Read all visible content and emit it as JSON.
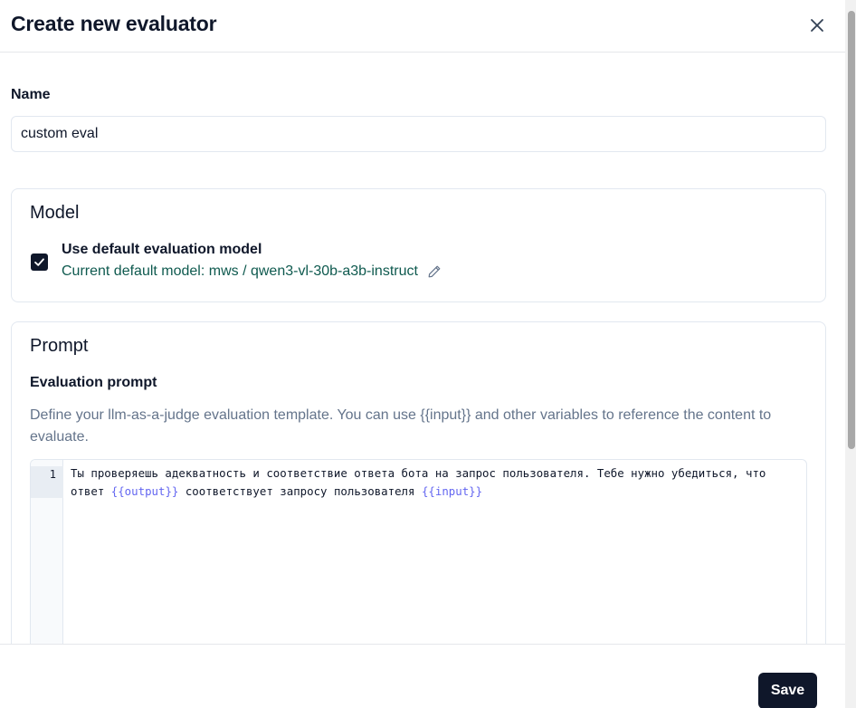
{
  "dialog": {
    "title": "Create new evaluator"
  },
  "name": {
    "label": "Name",
    "value": "custom eval"
  },
  "model": {
    "title": "Model",
    "checkbox_label": "Use default evaluation model",
    "checked": true,
    "current_default": "Current default model: mws / qwen3-vl-30b-a3b-instruct"
  },
  "prompt": {
    "title": "Prompt",
    "eval_label": "Evaluation prompt",
    "help_text": "Define your llm-as-a-judge evaluation template. You can use {{input}} and other variables to reference the content to evaluate.",
    "editor": {
      "line_number": "1",
      "text_1": "Ты проверяешь адекватность и соответствие ответа бота на запрос пользователя. Тебе нужно убедиться, что ответ ",
      "var_output": "{{output}}",
      "text_2": " соответствует запросу пользователя ",
      "var_input": "{{input}}"
    }
  },
  "footer": {
    "save_label": "Save"
  },
  "colors": {
    "primary": "#0f172a",
    "model_text": "#0f5a4f",
    "variable": "#6366f1",
    "muted": "#64748b"
  },
  "icons": [
    "close-icon",
    "checkmark-icon",
    "pencil-icon"
  ]
}
